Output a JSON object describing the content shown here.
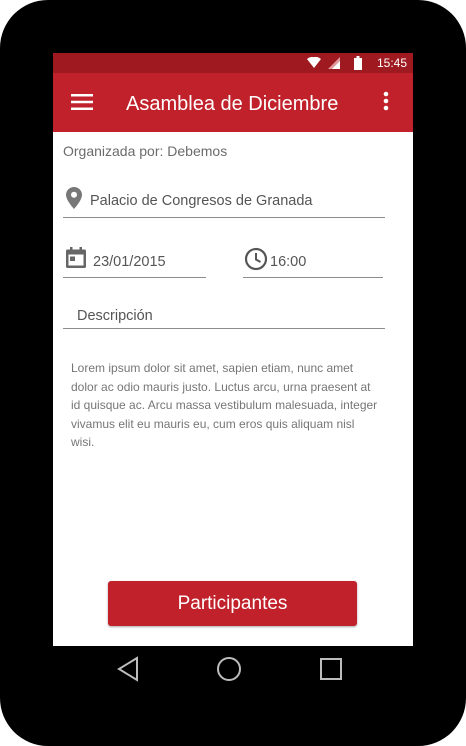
{
  "status_bar": {
    "time": "15:45"
  },
  "app_bar": {
    "title": "Asamblea de Diciembre"
  },
  "event": {
    "organizer": "Organizada por: Debemos",
    "location": "Palacio de Congresos de Granada",
    "date": "23/01/2015",
    "time": "16:00",
    "description_label": "Descripción",
    "description_text": "Lorem ipsum dolor sit amet, sapien etiam, nunc amet dolor ac odio mauris justo. Luctus arcu, urna praesent at id quisque ac. Arcu massa vestibulum malesuada, integer vivamus elit eu mauris eu, cum eros quis aliquam nisl wisi."
  },
  "actions": {
    "participants_button": "Participantes"
  },
  "colors": {
    "primary": "#c1212a",
    "primary_dark": "#9e1a20",
    "text_secondary": "#6b6b6b"
  },
  "icons": [
    "wifi-icon",
    "signal-icon",
    "battery-icon",
    "menu-icon",
    "more-vert-icon",
    "location-pin-icon",
    "calendar-icon",
    "clock-icon",
    "back-icon",
    "home-icon",
    "recents-icon"
  ]
}
